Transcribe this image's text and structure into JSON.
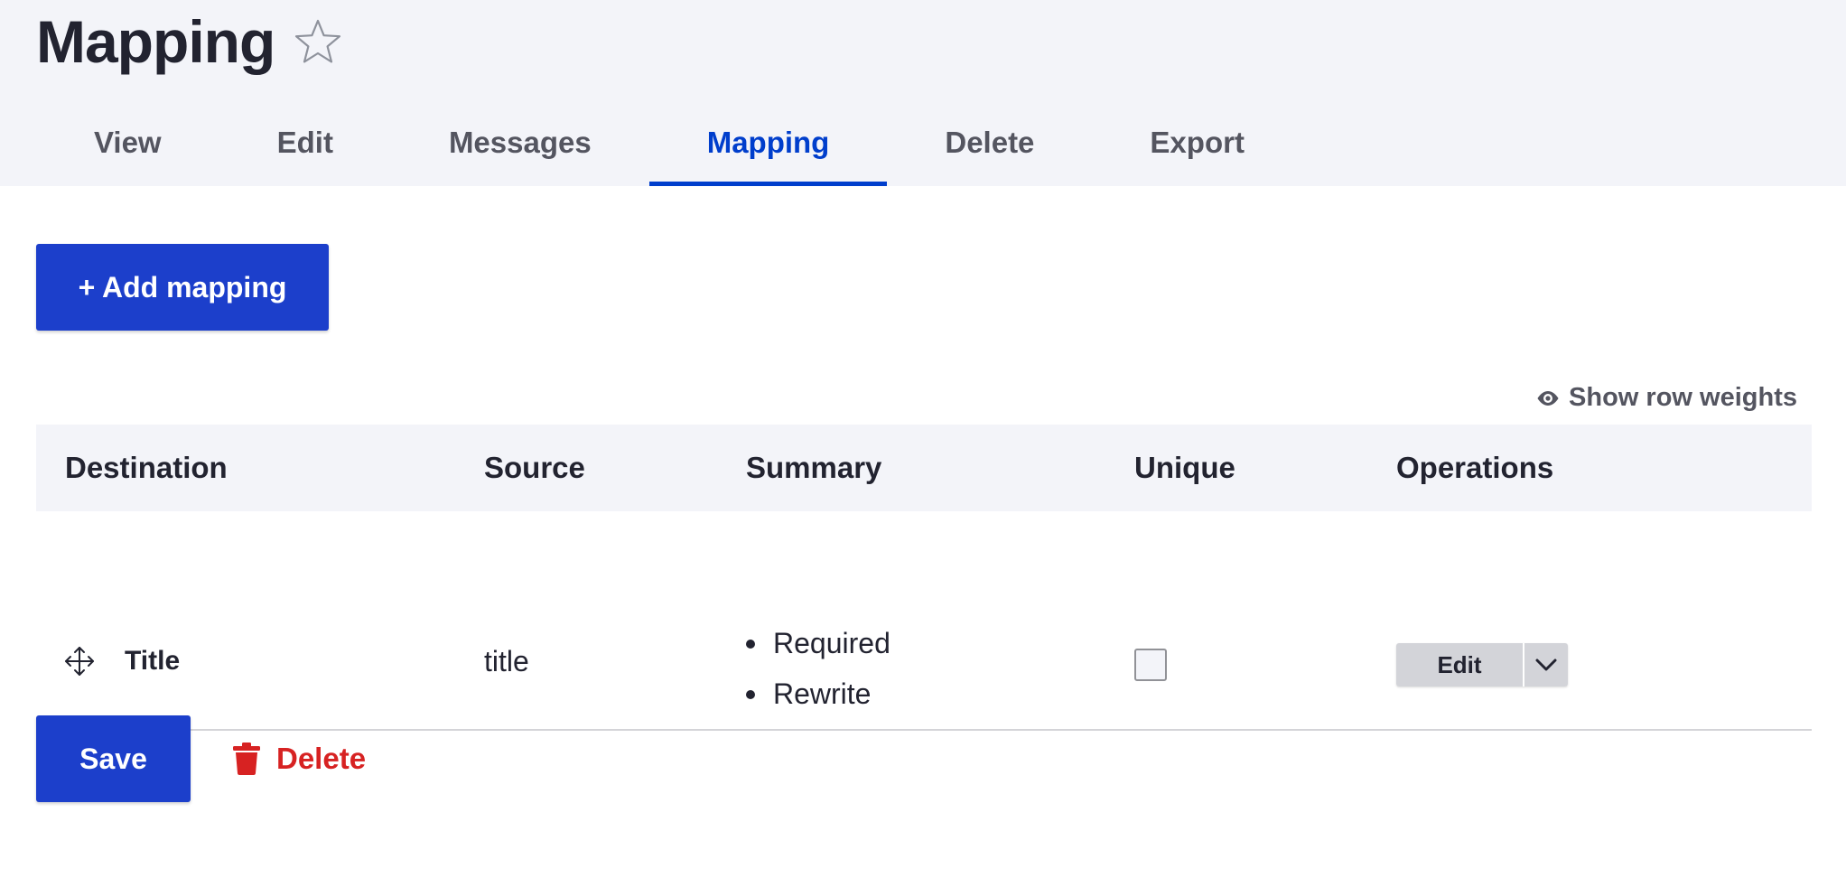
{
  "header": {
    "title": "Mapping",
    "star_icon": "star-outline-icon"
  },
  "tabs": [
    {
      "label": "View",
      "active": false
    },
    {
      "label": "Edit",
      "active": false
    },
    {
      "label": "Messages",
      "active": false
    },
    {
      "label": "Mapping",
      "active": true
    },
    {
      "label": "Delete",
      "active": false
    },
    {
      "label": "Export",
      "active": false
    }
  ],
  "actions": {
    "add_mapping_label": "+ Add mapping",
    "show_row_weights_label": "Show row weights"
  },
  "table": {
    "columns": [
      "Destination",
      "Source",
      "Summary",
      "Unique",
      "Operations"
    ],
    "rows": [
      {
        "destination": "Title",
        "source": "title",
        "summary": [
          "Required",
          "Rewrite"
        ],
        "unique": false,
        "operation_label": "Edit"
      }
    ]
  },
  "form_actions": {
    "save_label": "Save",
    "delete_label": "Delete"
  },
  "colors": {
    "accent": "#003ecc",
    "primary_button": "#1c3fcb",
    "danger": "#d72222",
    "header_bg": "#f3f4f9"
  }
}
